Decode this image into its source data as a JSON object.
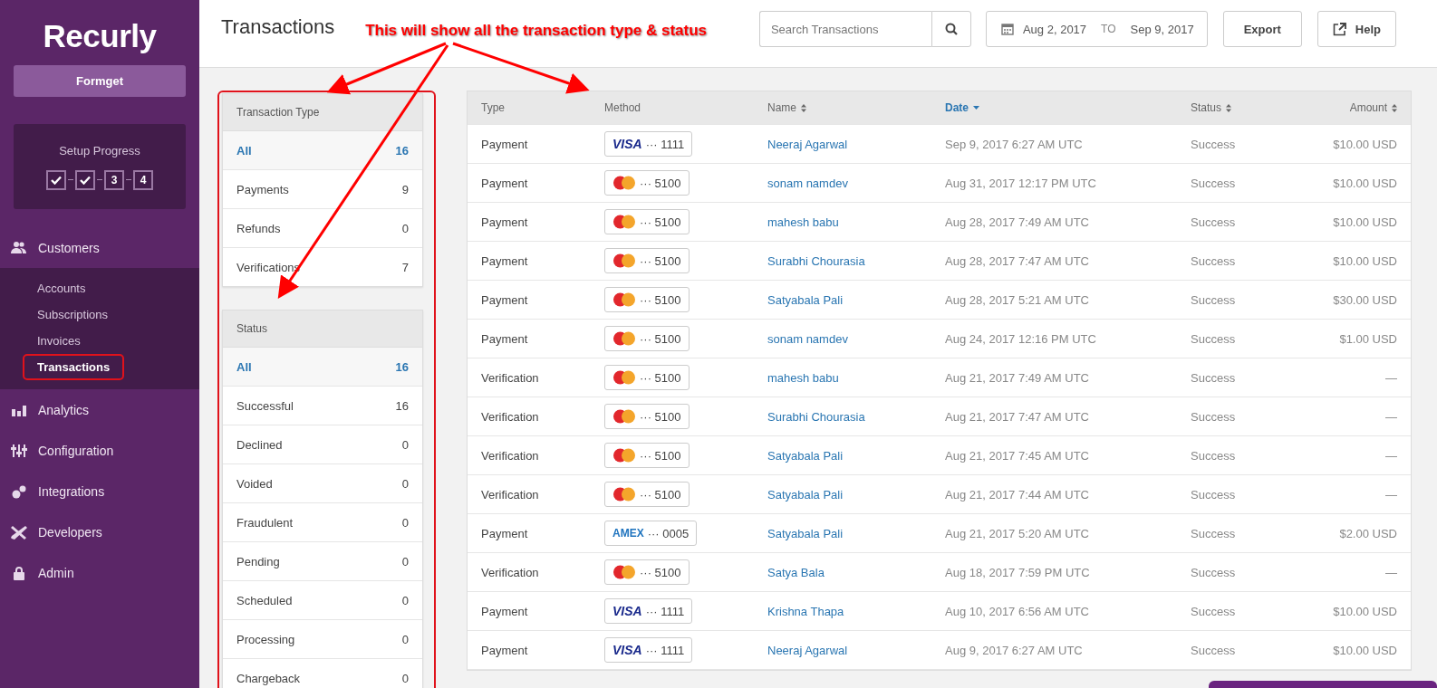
{
  "sidebar": {
    "logo": "Recurly",
    "account_button": "Formget",
    "setup": {
      "title": "Setup Progress",
      "steps": [
        {
          "done": true
        },
        {
          "done": true
        },
        {
          "label": "3",
          "done": false
        },
        {
          "label": "4",
          "done": false
        }
      ]
    },
    "nav": [
      {
        "label": "Customers",
        "children": [
          {
            "label": "Accounts",
            "selected": false
          },
          {
            "label": "Subscriptions",
            "selected": false
          },
          {
            "label": "Invoices",
            "selected": false
          },
          {
            "label": "Transactions",
            "selected": true
          }
        ]
      },
      {
        "label": "Analytics"
      },
      {
        "label": "Configuration"
      },
      {
        "label": "Integrations"
      },
      {
        "label": "Developers"
      },
      {
        "label": "Admin"
      }
    ]
  },
  "header": {
    "title": "Transactions",
    "annotation": "This will show all the transaction type & status",
    "search": {
      "placeholder": "Search Transactions"
    },
    "date_range": {
      "from": "Aug 2, 2017",
      "separator": "TO",
      "to": "Sep 9, 2017"
    },
    "export_button": "Export",
    "help_button": "Help"
  },
  "filters": [
    {
      "title": "Transaction Type",
      "items": [
        {
          "label": "All",
          "count": "16",
          "selected": true
        },
        {
          "label": "Payments",
          "count": "9",
          "selected": false
        },
        {
          "label": "Refunds",
          "count": "0",
          "selected": false
        },
        {
          "label": "Verifications",
          "count": "7",
          "selected": false
        }
      ]
    },
    {
      "title": "Status",
      "items": [
        {
          "label": "All",
          "count": "16",
          "selected": true
        },
        {
          "label": "Successful",
          "count": "16",
          "selected": false
        },
        {
          "label": "Declined",
          "count": "0",
          "selected": false
        },
        {
          "label": "Voided",
          "count": "0",
          "selected": false
        },
        {
          "label": "Fraudulent",
          "count": "0",
          "selected": false
        },
        {
          "label": "Pending",
          "count": "0",
          "selected": false
        },
        {
          "label": "Scheduled",
          "count": "0",
          "selected": false
        },
        {
          "label": "Processing",
          "count": "0",
          "selected": false
        },
        {
          "label": "Chargeback",
          "count": "0",
          "selected": false
        }
      ]
    }
  ],
  "table": {
    "columns": [
      {
        "label": "Type",
        "kind": "plain",
        "selected": false
      },
      {
        "label": "Method",
        "kind": "plain",
        "selected": false
      },
      {
        "label": "Name",
        "kind": "sortable",
        "selected": false
      },
      {
        "label": "Date",
        "kind": "sorted",
        "selected": true
      },
      {
        "label": "Status",
        "kind": "sortable",
        "selected": false
      },
      {
        "label": "Amount",
        "kind": "sortable",
        "selected": false
      }
    ],
    "rows": [
      {
        "type": "Payment",
        "method": {
          "kind": "visa",
          "label": "VISA",
          "last4": "··· 1111"
        },
        "name": "Neeraj Agarwal",
        "date": "Sep 9, 2017 6:27 AM UTC",
        "status": "Success",
        "amount": "$10.00 USD"
      },
      {
        "type": "Payment",
        "method": {
          "kind": "mastercard",
          "last4": "··· 5100"
        },
        "name": "sonam namdev",
        "date": "Aug 31, 2017 12:17 PM UTC",
        "status": "Success",
        "amount": "$10.00 USD"
      },
      {
        "type": "Payment",
        "method": {
          "kind": "mastercard",
          "last4": "··· 5100"
        },
        "name": "mahesh babu",
        "date": "Aug 28, 2017 7:49 AM UTC",
        "status": "Success",
        "amount": "$10.00 USD"
      },
      {
        "type": "Payment",
        "method": {
          "kind": "mastercard",
          "last4": "··· 5100"
        },
        "name": "Surabhi Chourasia",
        "date": "Aug 28, 2017 7:47 AM UTC",
        "status": "Success",
        "amount": "$10.00 USD"
      },
      {
        "type": "Payment",
        "method": {
          "kind": "mastercard",
          "last4": "··· 5100"
        },
        "name": "Satyabala Pali",
        "date": "Aug 28, 2017 5:21 AM UTC",
        "status": "Success",
        "amount": "$30.00 USD"
      },
      {
        "type": "Payment",
        "method": {
          "kind": "mastercard",
          "last4": "··· 5100"
        },
        "name": "sonam namdev",
        "date": "Aug 24, 2017 12:16 PM UTC",
        "status": "Success",
        "amount": "$1.00 USD"
      },
      {
        "type": "Verification",
        "method": {
          "kind": "mastercard",
          "last4": "··· 5100"
        },
        "name": "mahesh babu",
        "date": "Aug 21, 2017 7:49 AM UTC",
        "status": "Success",
        "amount": "—"
      },
      {
        "type": "Verification",
        "method": {
          "kind": "mastercard",
          "last4": "··· 5100"
        },
        "name": "Surabhi Chourasia",
        "date": "Aug 21, 2017 7:47 AM UTC",
        "status": "Success",
        "amount": "—"
      },
      {
        "type": "Verification",
        "method": {
          "kind": "mastercard",
          "last4": "··· 5100"
        },
        "name": "Satyabala Pali",
        "date": "Aug 21, 2017 7:45 AM UTC",
        "status": "Success",
        "amount": "—"
      },
      {
        "type": "Verification",
        "method": {
          "kind": "mastercard",
          "last4": "··· 5100"
        },
        "name": "Satyabala Pali",
        "date": "Aug 21, 2017 7:44 AM UTC",
        "status": "Success",
        "amount": "—"
      },
      {
        "type": "Payment",
        "method": {
          "kind": "amex",
          "label": "AMEX",
          "last4": "··· 0005"
        },
        "name": "Satyabala Pali",
        "date": "Aug 21, 2017 5:20 AM UTC",
        "status": "Success",
        "amount": "$2.00 USD"
      },
      {
        "type": "Verification",
        "method": {
          "kind": "mastercard",
          "last4": "··· 5100"
        },
        "name": "Satya Bala",
        "date": "Aug 18, 2017 7:59 PM UTC",
        "status": "Success",
        "amount": "—"
      },
      {
        "type": "Payment",
        "method": {
          "kind": "visa",
          "label": "VISA",
          "last4": "··· 1111"
        },
        "name": "Krishna Thapa",
        "date": "Aug 10, 2017 6:56 AM UTC",
        "status": "Success",
        "amount": "$10.00 USD"
      },
      {
        "type": "Payment",
        "method": {
          "kind": "visa",
          "label": "VISA",
          "last4": "··· 1111"
        },
        "name": "Neeraj Agarwal",
        "date": "Aug 9, 2017 6:27 AM UTC",
        "status": "Success",
        "amount": "$10.00 USD"
      }
    ]
  }
}
